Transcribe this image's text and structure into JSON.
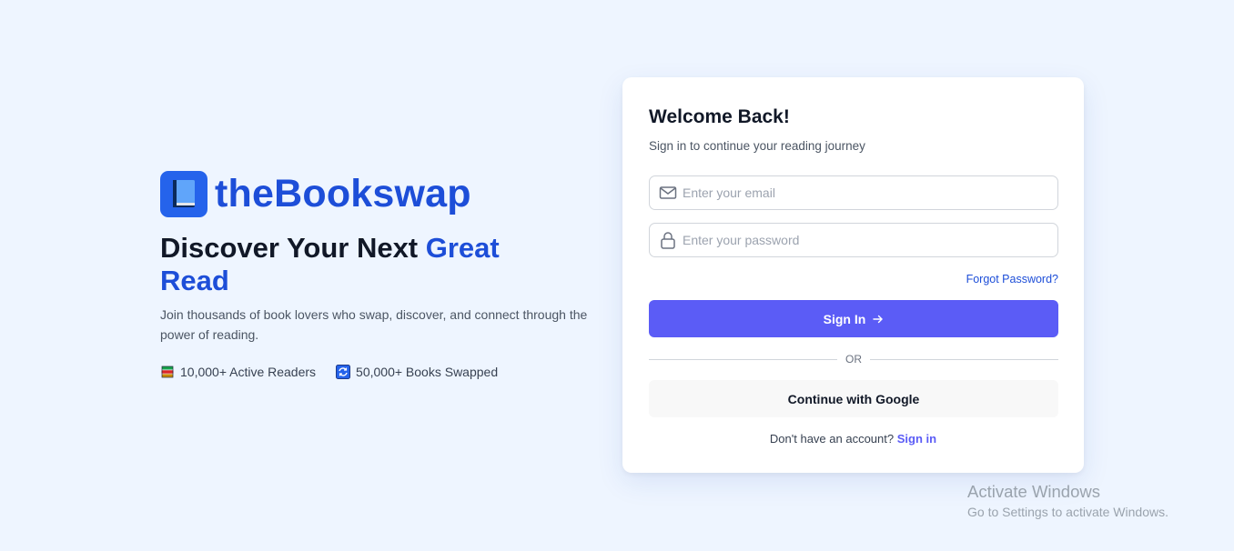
{
  "brand": {
    "name": "theBookswap",
    "icon": "book-icon",
    "accent_color": "#1d4ed8"
  },
  "hero": {
    "headline_part1": "Discover Your Next ",
    "headline_accent": "Great Read",
    "subtitle": "Join thousands of book lovers who swap, discover, and connect through the power of reading.",
    "stats": [
      {
        "icon": "books-stack-icon",
        "label": "10,000+ Active Readers"
      },
      {
        "icon": "swap-cycle-icon",
        "label": "50,000+ Books Swapped"
      }
    ]
  },
  "login": {
    "title": "Welcome Back!",
    "subtitle": "Sign in to continue your reading journey",
    "email_placeholder": "Enter your email",
    "email_value": "",
    "password_placeholder": "Enter your password",
    "password_value": "",
    "forgot_label": "Forgot Password?",
    "submit_label": "Sign In",
    "divider_label": "OR",
    "google_label": "Continue with Google",
    "register_prompt": "Don't have an account?",
    "register_link": "Sign in",
    "button_color": "#5b5cf6"
  },
  "watermark": {
    "title": "Activate Windows",
    "subtitle": "Go to Settings to activate Windows."
  }
}
